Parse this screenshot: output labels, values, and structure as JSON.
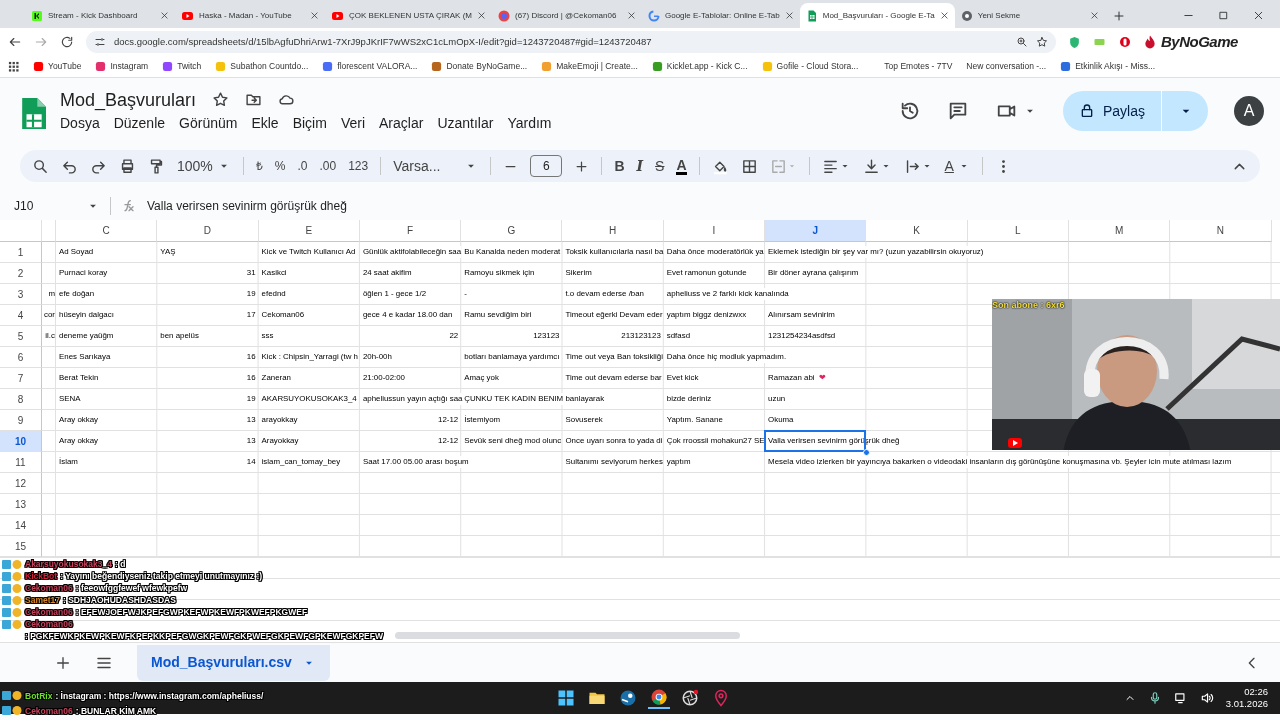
{
  "browser": {
    "tabs": [
      {
        "title": "Stream - Kick Dashboard",
        "kind": "kick",
        "selected": false
      },
      {
        "title": "Haska - Madan - YouTube",
        "kind": "youtube",
        "selected": false
      },
      {
        "title": "ÇOK BEKLENEN USTA ÇIRAK (M",
        "kind": "youtube",
        "selected": false
      },
      {
        "title": "(67) Discord | @Cekoman06",
        "kind": "discord",
        "selected": false
      },
      {
        "title": "Google E-Tablolar: Online E-Tab",
        "kind": "google",
        "selected": false
      },
      {
        "title": "Mod_Başvuruları - Google E-Ta",
        "kind": "sheets",
        "selected": true
      },
      {
        "title": "Yeni Sekme",
        "kind": "chrome",
        "selected": false
      }
    ],
    "address": "docs.google.com/spreadsheets/d/15lbAgfuDhriArw1-7XrJ9pJKrIF7wWS2xC1cLmOpX-I/edit?gid=1243720487#gid=1243720487",
    "bookmarks": [
      {
        "label": "YouTube",
        "color": "#ff0000"
      },
      {
        "label": "Instagram",
        "color": "#e1306c"
      },
      {
        "label": "Twitch",
        "color": "#9146ff"
      },
      {
        "label": "Subathon Countdo...",
        "color": "#f4c20d"
      },
      {
        "label": "florescent VALORA...",
        "color": "#4a6cf7"
      },
      {
        "label": "Donate ByNoGame...",
        "color": "#b5651d"
      },
      {
        "label": "MakeEmoji | Create...",
        "color": "#f0a030"
      },
      {
        "label": "Kicklet.app - Kick C...",
        "color": "#3a9d23"
      },
      {
        "label": "Gofile - Cloud Stora...",
        "color": "#f4c20d"
      },
      {
        "label": "Top Emotes - 7TV"
      },
      {
        "label": "New conversation -..."
      },
      {
        "label": "Etkinlik Akışı - Miss...",
        "color": "#2d6cdf"
      }
    ],
    "extension_label": "ByNoGame"
  },
  "document": {
    "title": "Mod_Başvuruları",
    "menu": [
      "Dosya",
      "Düzenle",
      "Görünüm",
      "Ekle",
      "Biçim",
      "Veri",
      "Araçlar",
      "Uzantılar",
      "Yardım"
    ],
    "share_label": "Paylaş",
    "avatar": "A"
  },
  "toolbar": {
    "zoom": "100%",
    "currency": "₺",
    "percent": "%",
    "decrease_decimals": ".0",
    "increase_decimals": ".00",
    "number_format": "123",
    "font": "Varsa...",
    "font_size": "6",
    "bold": "B",
    "italic": "I",
    "strikethrough": "S",
    "text_color": "A",
    "text_rotation": "A"
  },
  "formula_bar": {
    "cell": "J10",
    "formula": "Valla verirsen sevinirm görüşrük dheğ"
  },
  "grid": {
    "columns": [
      {
        "letter": "C",
        "selected": false
      },
      {
        "letter": "D",
        "selected": false
      },
      {
        "letter": "E",
        "selected": false
      },
      {
        "letter": "F",
        "selected": false
      },
      {
        "letter": "G",
        "selected": false
      },
      {
        "letter": "H",
        "selected": false
      },
      {
        "letter": "I",
        "selected": false
      },
      {
        "letter": "J",
        "selected": true
      },
      {
        "letter": "K",
        "selected": false
      },
      {
        "letter": "L",
        "selected": false
      },
      {
        "letter": "M",
        "selected": false
      },
      {
        "letter": "N",
        "selected": false
      }
    ],
    "rows": [
      {
        "number": "1",
        "selected": false,
        "cells": {
          "c": "Ad Soyad",
          "d": "YAŞ",
          "e": "Kick ve Twitch Kullanıcı Ad",
          "f": "Günlük aktifolabileceğin saa",
          "g": "Bu Kanalda neden moderat",
          "h": "Toksik kullanıcılarla nasıl ba",
          "i": "Daha önce moderatörlük ya",
          "j": "Eklemek istediğin bir şey var mı? (uzun yazabilirsin okuyoruz)"
        }
      },
      {
        "number": "2",
        "selected": false,
        "cells": {
          "c": "Purnaci koray",
          "d": {
            "text": "31",
            "right_aligned": true
          },
          "e": "Kasikci",
          "f": "24 saat akifim",
          "g": "Ramoyu sikmek için",
          "h": "Sikerim",
          "i": "Evet ramonun gotunde",
          "j": "Bir döner ayrana çalışırım"
        }
      },
      {
        "number": "3",
        "selected": false,
        "cells": {
          "b": {
            "text": "m",
            "right_aligned": true
          },
          "c": "efe doğan",
          "d": {
            "text": "19",
            "right_aligned": true
          },
          "e": "efednd",
          "f": "öğlen 1 - gece 1/2",
          "g": "-",
          "h": "t.o devam ederse /ban",
          "i": "apheliuss ve 2 farklı kick kanalında"
        }
      },
      {
        "number": "4",
        "selected": false,
        "cells": {
          "b": {
            "text": "cor",
            "right_aligned": true
          },
          "c": "hüseyin dalgacı",
          "d": {
            "text": "17",
            "right_aligned": true
          },
          "e": "Cekoman06",
          "f": "gece 4 e kadar 18.00 dan",
          "g": "Ramu sevdiğim biri",
          "h": "Timeout eğerki Devam eder",
          "i": "yaptım biggz denizwxx",
          "j": "Alınırsam sevinirim"
        }
      },
      {
        "number": "5",
        "selected": false,
        "cells": {
          "b": {
            "text": "il.c",
            "right_aligned": true
          },
          "c": "deneme yaüğm",
          "d": "ben apelüs",
          "e": "sss",
          "f": {
            "text": "22",
            "right_aligned": true
          },
          "g": {
            "text": "123123",
            "right_aligned": true
          },
          "h": {
            "text": "213123123",
            "right_aligned": true
          },
          "i": "sdfasd",
          "j": "1231254234asdfsd"
        }
      },
      {
        "number": "6",
        "selected": false,
        "cells": {
          "c": "Enes Sarıkaya",
          "d": {
            "text": "16",
            "right_aligned": true
          },
          "e": "Kick : Chipsin_Yarragi (tw h",
          "f": "20h-00h",
          "g": "botları banlamaya yardımcı",
          "h": "Time out veya Ban toksikliği",
          "i": "Daha önce hiç modluk yapmadım."
        }
      },
      {
        "number": "7",
        "selected": false,
        "cells": {
          "c": "Berat Tekin",
          "d": {
            "text": "16",
            "right_aligned": true
          },
          "e": "Zaneran",
          "f": "21:00-02:00",
          "g": "Amaç yok",
          "h": "Time out devam ederse bar",
          "i": "Evet kick",
          "j": "Ramazan abi"
        },
        "emoji": "❤"
      },
      {
        "number": "8",
        "selected": false,
        "cells": {
          "c": "SENA",
          "d": {
            "text": "19",
            "right_aligned": true
          },
          "e": "AKARSUYOKUSOKAK3_4",
          "f": "apheliussun yayın açtığı saa",
          "g": "ÇUNKU TEK KADIN BENIM",
          "h": "banlayarak",
          "i": "bizde deriniz",
          "j": "uzun"
        }
      },
      {
        "number": "9",
        "selected": false,
        "cells": {
          "c": "Aray okkay",
          "d": {
            "text": "13",
            "right_aligned": true
          },
          "e": "arayokkay",
          "f": {
            "text": "12-12",
            "right_aligned": true
          },
          "g": "İstemiyom",
          "h": "Sovuserek",
          "i": "Yaptım. Sanane",
          "j": "Okuma"
        }
      },
      {
        "number": "10",
        "selected": true,
        "cells": {
          "c": "Aray okkay",
          "d": {
            "text": "13",
            "right_aligned": true
          },
          "e": "Arayokkay",
          "f": {
            "text": "12-12",
            "right_aligned": true
          },
          "g": "Sevük seni dheğ mod olunc",
          "h": "Once uyarı sonra to yada di",
          "i": "Çok rroossii mohakun27 SE",
          "j": "Valla verirsen sevinirm görüşrük dheğ"
        }
      },
      {
        "number": "11",
        "selected": false,
        "cells": {
          "c": "İslam",
          "d": {
            "text": "14",
            "right_aligned": true
          },
          "e": "islam_can_tomay_bey",
          "f": "Saat 17.00 05.00 arası boşum",
          "h": "Sultanımı seviyorum herkes",
          "i": "yaptım",
          "j": "Mesela video izlerken bir yayıncıya bakarken o videodaki insanların dış görünüşüne konuşmasına vb. Şeyler icin mute atılması lazım"
        }
      },
      {
        "number": "12",
        "selected": false,
        "cells": {}
      },
      {
        "number": "13",
        "selected": false,
        "cells": {}
      },
      {
        "number": "14",
        "selected": false,
        "cells": {}
      },
      {
        "number": "15",
        "selected": false,
        "cells": {}
      }
    ]
  },
  "sheet_tabs": [
    {
      "label": "Mod_Başvuruları.csv",
      "selected": true
    }
  ],
  "stream_overlay": {
    "webcam": {
      "kind": "picture",
      "label": "Son abone : 6xr6"
    },
    "chat": [
      {
        "user": "Akarsuyokusokak3_4",
        "text": ": d",
        "color": "#c8405c"
      },
      {
        "user": "KickBot",
        "text": ": Yayını beğendiyseniz takip etmeyi unutmayınız :)",
        "color": "#d0203a"
      },
      {
        "user": "Cekoman06",
        "text": ": feeowfggfewef wfewkpefw",
        "color": "#c8405c"
      },
      {
        "user": "Samet17",
        "text": ": SDHJAOHUDASHDASDAS",
        "color": "#d9892a"
      },
      {
        "user": "Cekoman06",
        "text": ": EFEWJOEFWJKPEFGWPKEFWPKEWFPKWEFPKGWEF",
        "color": "#c8405c"
      },
      {
        "user": "Cekoman06",
        "text": ": PGKFEWKPKEWPKEWFKPEPKKPEFGWGKPEWFGKPWEFGKPEWFGPKEWFGKPEFW",
        "color": "#c8405c"
      },
      {
        "user": "BotRix",
        "text": ": İnstagram : https://www.instagram.com/apheliuss/",
        "color": "#6ee02a"
      },
      {
        "user": "Cekoman06",
        "text": ": BUNLAR KİM AMK",
        "color": "#c8405c"
      }
    ]
  },
  "taskbar": {
    "time": "02:26",
    "date": "3.01.2026"
  }
}
